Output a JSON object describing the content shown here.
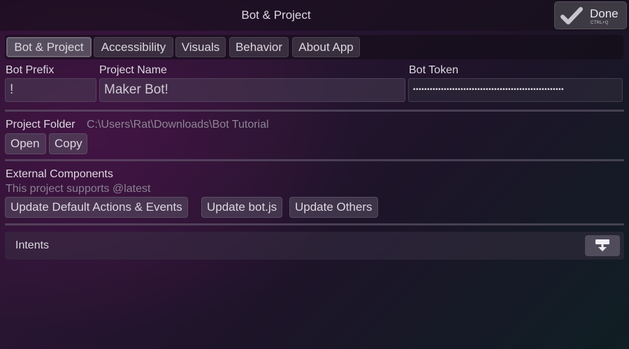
{
  "window": {
    "title": "Bot & Project",
    "done_label": "Done",
    "done_shortcut": "CTRL+Q"
  },
  "tabs": [
    {
      "label": "Bot & Project",
      "active": true
    },
    {
      "label": "Accessibility",
      "active": false
    },
    {
      "label": "Visuals",
      "active": false
    },
    {
      "label": "Behavior",
      "active": false
    },
    {
      "label": "About App",
      "active": false
    }
  ],
  "bot_settings": {
    "prefix_label": "Bot Prefix",
    "prefix_value": "!",
    "project_name_label": "Project Name",
    "project_name_value": "Maker Bot!",
    "token_label": "Bot Token",
    "token_value": "••••••••••••••••••••••••••••••••••••••••••••••••••••••"
  },
  "project_folder": {
    "label": "Project Folder",
    "path": "C:\\Users\\Rat\\Downloads\\Bot Tutorial",
    "open_label": "Open",
    "copy_label": "Copy"
  },
  "external_components": {
    "heading": "External Components",
    "support_text": "This project supports @latest",
    "buttons": [
      "Update Default Actions & Events",
      "Update bot.js",
      "Update Others"
    ]
  },
  "intents": {
    "label": "Intents",
    "toggle_icon": "expand-down-icon"
  },
  "colors": {
    "accent": "#2a1533",
    "panel": "#3e3a44"
  }
}
